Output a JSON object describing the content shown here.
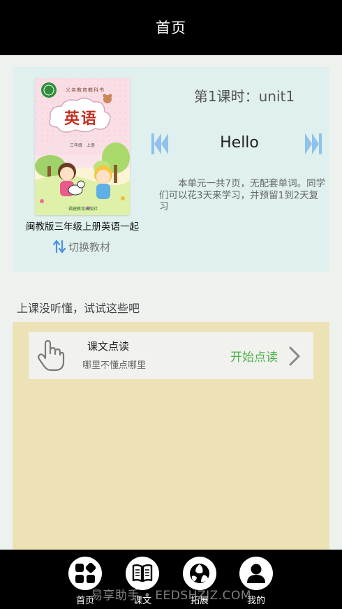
{
  "header": {
    "title": "首页"
  },
  "book": {
    "cover_title": "英语",
    "cover_series": "义务教育教科书",
    "cover_grade": "三年级",
    "cover_term": "上册",
    "cover_publisher": "福建教育出版社",
    "name": "闽教版三年级上册英语一起",
    "switch_label": "切换教材"
  },
  "lesson": {
    "title": "第1课时：unit1",
    "word": "Hello",
    "description": "本单元一共7页，无配套单词。同学们可以花3天来学习，并预留1到2天复习"
  },
  "practice": {
    "heading": "上课没听懂，试试这些吧",
    "card_title": "课文点读",
    "card_subtitle": "哪里不懂点哪里",
    "action_label": "开始点读"
  },
  "tabs": [
    {
      "label": "首页",
      "icon": "grid-icon"
    },
    {
      "label": "课文",
      "icon": "book-icon"
    },
    {
      "label": "拓展",
      "icon": "ball-icon"
    },
    {
      "label": "我的",
      "icon": "person-icon"
    }
  ],
  "watermark": "易享助手 • EEDSHZJZ.COM",
  "colors": {
    "topbar": "#000000",
    "hero_bg": "#dff0ee",
    "panel_bg": "#ede1b6",
    "accent_green": "#4fb24c",
    "nav_blue": "#8fc2ec"
  }
}
